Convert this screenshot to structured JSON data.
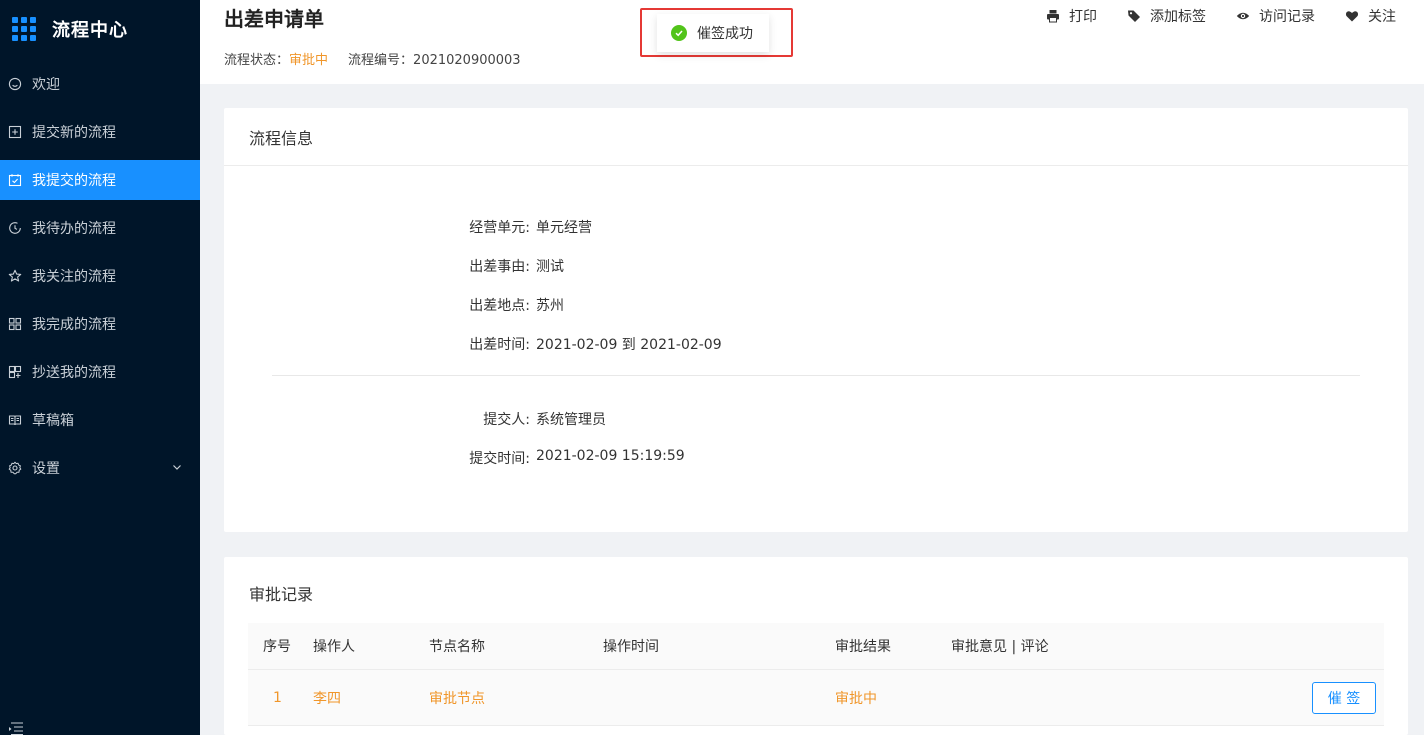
{
  "app": {
    "title": "流程中心"
  },
  "sidebar": {
    "items": [
      {
        "label": "欢迎",
        "icon": "smile-icon"
      },
      {
        "label": "提交新的流程",
        "icon": "plus-square-icon"
      },
      {
        "label": "我提交的流程",
        "icon": "check-square-icon",
        "active": true
      },
      {
        "label": "我待办的流程",
        "icon": "clock-icon"
      },
      {
        "label": "我关注的流程",
        "icon": "star-icon"
      },
      {
        "label": "我完成的流程",
        "icon": "appstore-icon"
      },
      {
        "label": "抄送我的流程",
        "icon": "copy-icon"
      },
      {
        "label": "草稿箱",
        "icon": "book-icon"
      },
      {
        "label": "设置",
        "icon": "gear-icon"
      }
    ]
  },
  "header": {
    "title": "出差申请单",
    "status_label": "流程状态：",
    "status_value": "审批中",
    "number_label": "流程编号：",
    "number_value": "2021020900003",
    "actions": {
      "print": "打印",
      "tag": "添加标签",
      "visits": "访问记录",
      "follow": "关注"
    }
  },
  "toast": {
    "message": "催签成功"
  },
  "process_info": {
    "title": "流程信息",
    "fields": [
      {
        "label": "经营单元:",
        "value": "单元经营"
      },
      {
        "label": "出差事由:",
        "value": "测试"
      },
      {
        "label": "出差地点:",
        "value": "苏州"
      },
      {
        "label": "出差时间:",
        "value": "2021-02-09 到 2021-02-09"
      }
    ],
    "submitter_label": "提交人:",
    "submitter_value": "系统管理员",
    "submit_time_label": "提交时间:",
    "submit_time_value": "2021-02-09 15:19:59"
  },
  "approval": {
    "title": "审批记录",
    "columns": [
      "序号",
      "操作人",
      "节点名称",
      "操作时间",
      "审批结果",
      "审批意见 | 评论"
    ],
    "rows": [
      {
        "index": "1",
        "operator": "李四",
        "node": "审批节点",
        "time": "",
        "result": "审批中",
        "comment": ""
      }
    ],
    "urge_button": "催 签"
  },
  "colors": {
    "accent": "#1890ff",
    "status": "#f0962a",
    "sidebar": "#001529",
    "success": "#52c41a",
    "highlight_frame": "#e53935"
  }
}
